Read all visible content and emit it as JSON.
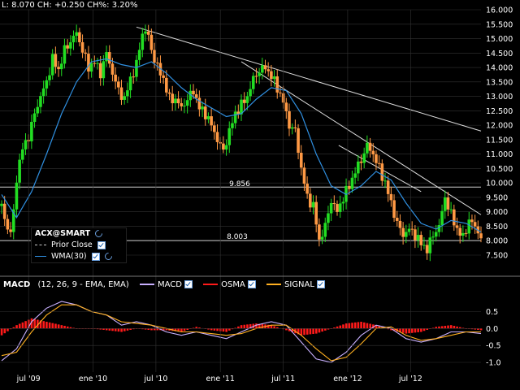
{
  "header": {
    "ohlc_text": "L: 8.070 CH: +0.250 CH%: 3.20%"
  },
  "legend": {
    "symbol": "ACX@SMART",
    "items": [
      {
        "label": "Prior Close",
        "style": "dashed",
        "color": "#cccccc"
      },
      {
        "label": "WMA(30)",
        "style": "solid",
        "color": "#2f8fe0"
      }
    ]
  },
  "annotations": {
    "high_level": "9.856",
    "low_level": "8.003"
  },
  "colors": {
    "up": "#22dd22",
    "down": "#ff9944",
    "wma": "#2f8fe0",
    "macd": "#c8b0ff",
    "osma": "#ff1a1a",
    "signal": "#ffb020",
    "trend": "#dddddd",
    "grid": "#333333"
  },
  "macd_panel": {
    "title": "MACD",
    "params": "(12, 26, 9 - EMA, EMA)",
    "items": [
      {
        "label": "MACD",
        "color": "#c8b0ff"
      },
      {
        "label": "OSMA",
        "color": "#ff1a1a"
      },
      {
        "label": "SIGNAL",
        "color": "#ffb020"
      }
    ]
  },
  "chart_data": [
    {
      "type": "candlestick",
      "title": "",
      "ylim": [
        7.5,
        16.0
      ],
      "y_ticks": [
        "16.000",
        "15.500",
        "15.000",
        "14.500",
        "14.000",
        "13.500",
        "13.000",
        "12.500",
        "12.000",
        "11.500",
        "11.000",
        "10.500",
        "10.000",
        "9.500",
        "9.000",
        "8.500",
        "8.000",
        "7.500"
      ],
      "x_ticks": [
        "jul '09",
        "ene '10",
        "jul '10",
        "ene '11",
        "jul '11",
        "ene '12",
        "jul '12"
      ],
      "close_path": [
        [
          0,
          9.2
        ],
        [
          4,
          8.4
        ],
        [
          7,
          8.3
        ],
        [
          10,
          10.2
        ],
        [
          14,
          11.2
        ],
        [
          18,
          11.6
        ],
        [
          22,
          12.4
        ],
        [
          26,
          13.0
        ],
        [
          30,
          13.5
        ],
        [
          34,
          14.3
        ],
        [
          38,
          13.9
        ],
        [
          42,
          14.6
        ],
        [
          46,
          14.9
        ],
        [
          50,
          15.2
        ],
        [
          54,
          14.6
        ],
        [
          58,
          14.0
        ],
        [
          62,
          14.2
        ],
        [
          66,
          13.8
        ],
        [
          70,
          14.5
        ],
        [
          74,
          13.8
        ],
        [
          78,
          13.2
        ],
        [
          82,
          12.9
        ],
        [
          86,
          13.6
        ],
        [
          90,
          14.1
        ],
        [
          94,
          15.2
        ],
        [
          97,
          15.3
        ],
        [
          100,
          14.6
        ],
        [
          104,
          14.0
        ],
        [
          108,
          13.6
        ],
        [
          112,
          12.9
        ],
        [
          116,
          12.9
        ],
        [
          120,
          12.6
        ],
        [
          124,
          12.9
        ],
        [
          128,
          13.2
        ],
        [
          132,
          12.6
        ],
        [
          136,
          12.4
        ],
        [
          140,
          12.0
        ],
        [
          144,
          11.5
        ],
        [
          148,
          11.1
        ],
        [
          152,
          11.8
        ],
        [
          156,
          12.4
        ],
        [
          160,
          12.7
        ],
        [
          164,
          13.0
        ],
        [
          168,
          13.6
        ],
        [
          172,
          13.9
        ],
        [
          176,
          14.0
        ],
        [
          180,
          13.7
        ],
        [
          184,
          13.3
        ],
        [
          188,
          12.8
        ],
        [
          192,
          12.0
        ],
        [
          196,
          11.8
        ],
        [
          200,
          10.5
        ],
        [
          204,
          9.5
        ],
        [
          208,
          9.2
        ],
        [
          212,
          8.0
        ],
        [
          216,
          8.5
        ],
        [
          220,
          9.4
        ],
        [
          224,
          9.0
        ],
        [
          228,
          9.5
        ],
        [
          232,
          9.9
        ],
        [
          236,
          10.4
        ],
        [
          240,
          10.8
        ],
        [
          244,
          11.3
        ],
        [
          248,
          11.0
        ],
        [
          252,
          10.5
        ],
        [
          256,
          10.0
        ],
        [
          260,
          9.3
        ],
        [
          264,
          8.6
        ],
        [
          268,
          8.2
        ],
        [
          272,
          8.4
        ],
        [
          276,
          8.2
        ],
        [
          280,
          7.9
        ],
        [
          284,
          7.7
        ],
        [
          288,
          8.2
        ],
        [
          292,
          8.5
        ],
        [
          296,
          9.5
        ],
        [
          300,
          8.9
        ],
        [
          304,
          8.4
        ],
        [
          308,
          8.1
        ],
        [
          312,
          8.7
        ],
        [
          316,
          8.5
        ],
        [
          320,
          8.1
        ]
      ],
      "wma_path": [
        [
          0,
          9.6
        ],
        [
          10,
          8.8
        ],
        [
          20,
          9.7
        ],
        [
          30,
          11.0
        ],
        [
          40,
          12.4
        ],
        [
          50,
          13.5
        ],
        [
          60,
          14.2
        ],
        [
          70,
          14.3
        ],
        [
          80,
          14.1
        ],
        [
          90,
          14.0
        ],
        [
          100,
          14.2
        ],
        [
          110,
          13.8
        ],
        [
          120,
          13.3
        ],
        [
          130,
          12.9
        ],
        [
          140,
          12.6
        ],
        [
          150,
          12.3
        ],
        [
          160,
          12.4
        ],
        [
          170,
          12.9
        ],
        [
          180,
          13.3
        ],
        [
          190,
          13.2
        ],
        [
          200,
          12.4
        ],
        [
          210,
          11.0
        ],
        [
          220,
          9.9
        ],
        [
          230,
          9.6
        ],
        [
          240,
          9.9
        ],
        [
          250,
          10.4
        ],
        [
          260,
          10.1
        ],
        [
          270,
          9.3
        ],
        [
          280,
          8.6
        ],
        [
          290,
          8.4
        ],
        [
          300,
          8.7
        ],
        [
          310,
          8.6
        ],
        [
          320,
          8.3
        ]
      ],
      "levels": [
        9.856,
        8.003
      ],
      "trendlines": [
        [
          [
            90,
            15.4
          ],
          [
            320,
            11.8
          ]
        ],
        [
          [
            160,
            14.2
          ],
          [
            320,
            8.9
          ]
        ],
        [
          [
            225,
            11.3
          ],
          [
            280,
            9.7
          ]
        ]
      ]
    },
    {
      "type": "line",
      "title": "MACD",
      "ylim": [
        -1.0,
        0.8
      ],
      "y_ticks": [
        "0.5",
        "0.0",
        "-0.5",
        "-1.0"
      ],
      "series": [
        {
          "name": "MACD",
          "values": [
            [
              0,
              -0.95
            ],
            [
              10,
              -0.6
            ],
            [
              20,
              0.2
            ],
            [
              30,
              0.6
            ],
            [
              40,
              0.8
            ],
            [
              50,
              0.7
            ],
            [
              60,
              0.5
            ],
            [
              70,
              0.4
            ],
            [
              80,
              0.1
            ],
            [
              90,
              0.2
            ],
            [
              100,
              0.1
            ],
            [
              110,
              -0.1
            ],
            [
              120,
              -0.2
            ],
            [
              130,
              -0.1
            ],
            [
              140,
              -0.2
            ],
            [
              150,
              -0.3
            ],
            [
              160,
              -0.1
            ],
            [
              170,
              0.1
            ],
            [
              180,
              0.2
            ],
            [
              190,
              0.1
            ],
            [
              200,
              -0.4
            ],
            [
              210,
              -0.9
            ],
            [
              220,
              -1.0
            ],
            [
              230,
              -0.7
            ],
            [
              240,
              -0.2
            ],
            [
              250,
              0.1
            ],
            [
              260,
              0.0
            ],
            [
              270,
              -0.3
            ],
            [
              280,
              -0.4
            ],
            [
              290,
              -0.3
            ],
            [
              300,
              -0.1
            ],
            [
              310,
              -0.1
            ],
            [
              320,
              -0.15
            ]
          ]
        },
        {
          "name": "OSMA",
          "values": [
            [
              0,
              -0.2
            ],
            [
              10,
              0.1
            ],
            [
              20,
              0.3
            ],
            [
              30,
              0.2
            ],
            [
              40,
              0.1
            ],
            [
              50,
              0.0
            ],
            [
              60,
              0.0
            ],
            [
              70,
              -0.05
            ],
            [
              80,
              -0.1
            ],
            [
              90,
              0.0
            ],
            [
              100,
              -0.05
            ],
            [
              110,
              -0.05
            ],
            [
              120,
              -0.1
            ],
            [
              130,
              0.05
            ],
            [
              140,
              -0.05
            ],
            [
              150,
              -0.1
            ],
            [
              160,
              0.1
            ],
            [
              170,
              0.15
            ],
            [
              180,
              0.1
            ],
            [
              190,
              -0.05
            ],
            [
              200,
              -0.2
            ],
            [
              210,
              -0.15
            ],
            [
              220,
              0.0
            ],
            [
              230,
              0.15
            ],
            [
              240,
              0.2
            ],
            [
              250,
              0.1
            ],
            [
              260,
              -0.05
            ],
            [
              270,
              -0.15
            ],
            [
              280,
              -0.1
            ],
            [
              290,
              0.05
            ],
            [
              300,
              0.1
            ],
            [
              310,
              0.0
            ],
            [
              320,
              -0.05
            ]
          ]
        },
        {
          "name": "SIGNAL",
          "values": [
            [
              0,
              -0.8
            ],
            [
              10,
              -0.7
            ],
            [
              20,
              -0.1
            ],
            [
              30,
              0.4
            ],
            [
              40,
              0.7
            ],
            [
              50,
              0.7
            ],
            [
              60,
              0.5
            ],
            [
              70,
              0.4
            ],
            [
              80,
              0.2
            ],
            [
              90,
              0.15
            ],
            [
              100,
              0.1
            ],
            [
              110,
              0.0
            ],
            [
              120,
              -0.1
            ],
            [
              130,
              -0.1
            ],
            [
              140,
              -0.15
            ],
            [
              150,
              -0.2
            ],
            [
              160,
              -0.15
            ],
            [
              170,
              0.0
            ],
            [
              180,
              0.1
            ],
            [
              190,
              0.1
            ],
            [
              200,
              -0.2
            ],
            [
              210,
              -0.6
            ],
            [
              220,
              -0.95
            ],
            [
              230,
              -0.85
            ],
            [
              240,
              -0.45
            ],
            [
              250,
              0.0
            ],
            [
              260,
              0.05
            ],
            [
              270,
              -0.2
            ],
            [
              280,
              -0.35
            ],
            [
              290,
              -0.3
            ],
            [
              300,
              -0.2
            ],
            [
              310,
              -0.1
            ],
            [
              320,
              -0.1
            ]
          ]
        }
      ]
    }
  ]
}
